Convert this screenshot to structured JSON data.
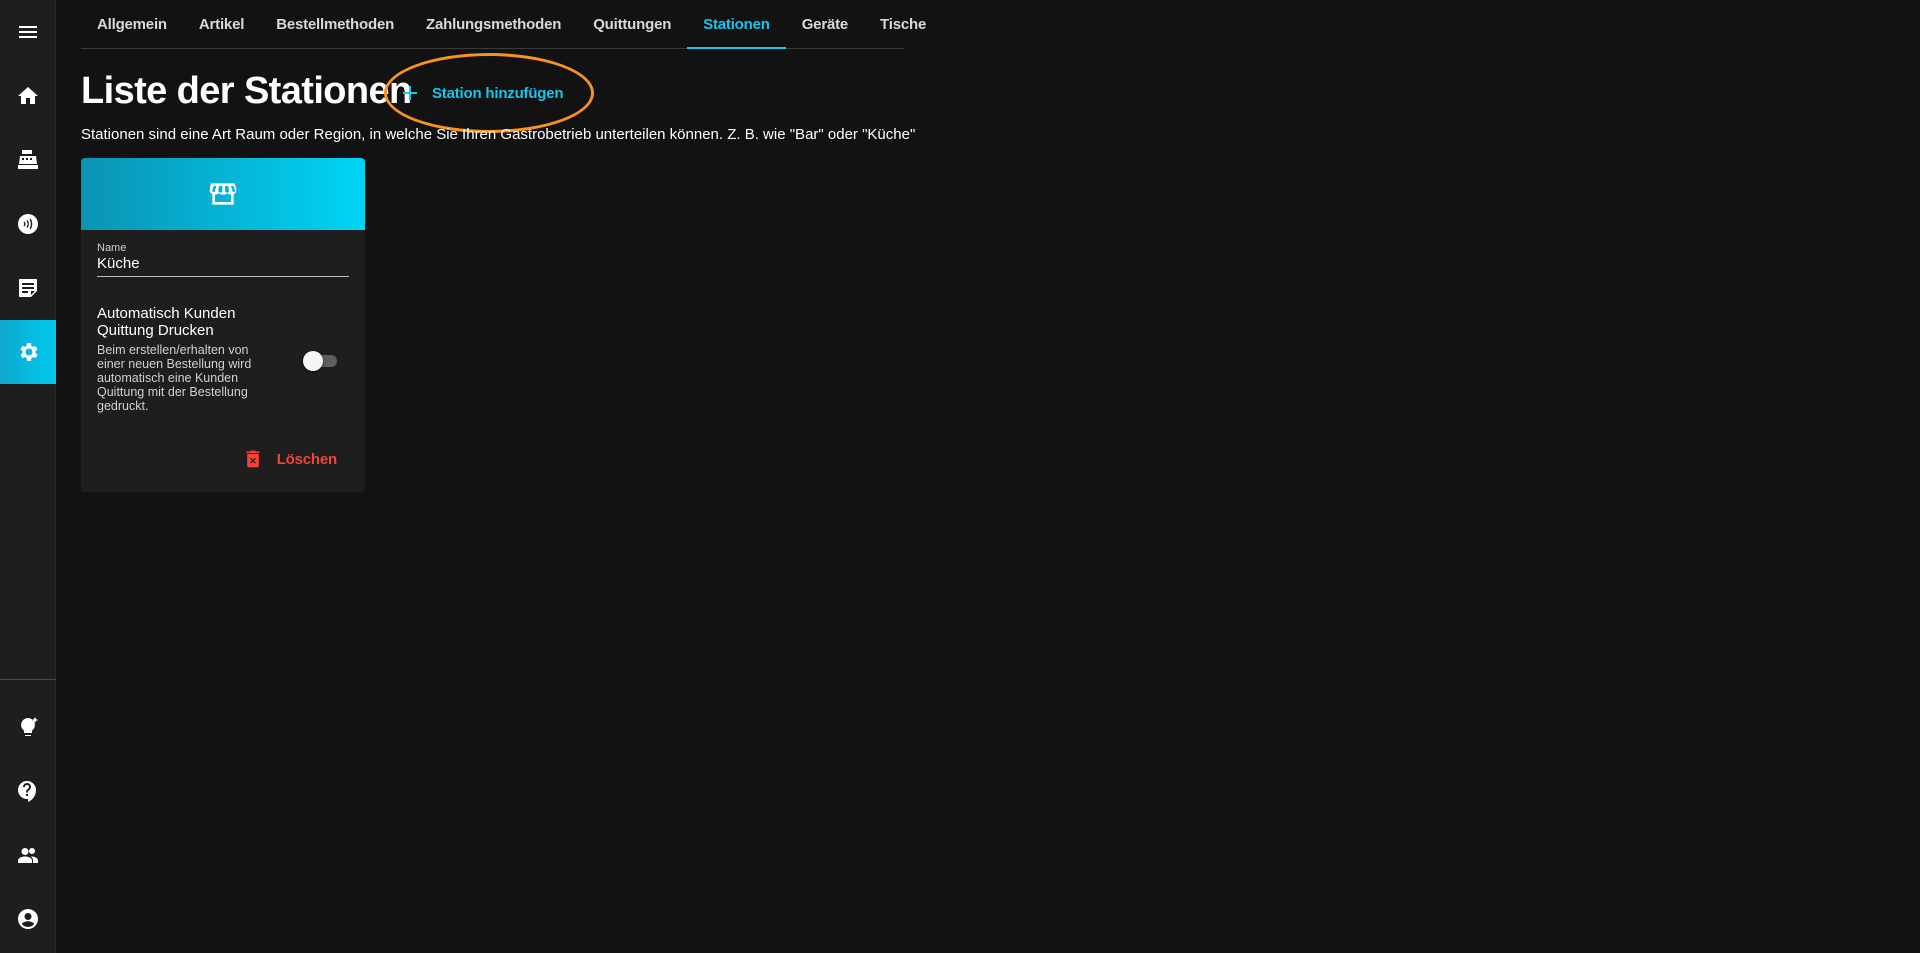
{
  "sidebar": {
    "items": [
      {
        "name": "menu",
        "icon": "menu-icon"
      },
      {
        "name": "home",
        "icon": "home-icon"
      },
      {
        "name": "cash-register",
        "icon": "cash-register-icon"
      },
      {
        "name": "contactless",
        "icon": "contactless-icon"
      },
      {
        "name": "orders",
        "icon": "order-notes-icon"
      },
      {
        "name": "settings",
        "icon": "gear-icon",
        "active": true
      },
      {
        "name": "tips",
        "icon": "lightbulb-icon"
      },
      {
        "name": "help",
        "icon": "help-icon"
      },
      {
        "name": "users",
        "icon": "people-icon"
      },
      {
        "name": "account",
        "icon": "account-circle-icon"
      }
    ]
  },
  "tabs": [
    {
      "label": "Allgemein"
    },
    {
      "label": "Artikel"
    },
    {
      "label": "Bestellmethoden"
    },
    {
      "label": "Zahlungsmethoden"
    },
    {
      "label": "Quittungen"
    },
    {
      "label": "Stationen",
      "active": true
    },
    {
      "label": "Geräte"
    },
    {
      "label": "Tische"
    }
  ],
  "page": {
    "title": "Liste der Stationen",
    "add_button": "Station hinzufügen",
    "subtitle": "Stationen sind eine Art Raum oder Region, in welche Sie Ihren Gastrobetrieb unterteilen können. Z. B. wie \"Bar\" oder \"Küche\""
  },
  "station_card": {
    "icon": "storefront-icon",
    "name_label": "Name",
    "name_value": "Küche",
    "option_title": "Automatisch Kunden Quittung Drucken",
    "option_desc": "Beim erstellen/erhalten von einer neuen Bestellung wird automatisch eine Kunden Quittung mit der Bestellung gedruckt.",
    "toggle_on": false,
    "delete_label": "Löschen"
  },
  "colors": {
    "accent": "#17c6ec",
    "danger": "#f44336",
    "highlight": "#f7931e",
    "background": "#121212"
  }
}
